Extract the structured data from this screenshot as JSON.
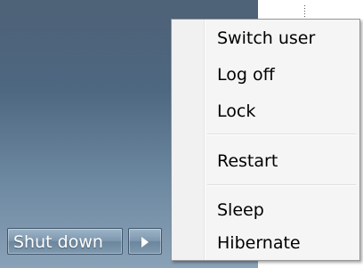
{
  "start_menu": {
    "shutdown_label": "Shut down"
  },
  "power_menu": {
    "items": [
      {
        "label": "Switch user"
      },
      {
        "label": "Log off"
      },
      {
        "label": "Lock"
      },
      {
        "label": "Restart"
      },
      {
        "label": "Sleep"
      },
      {
        "label": "Hibernate"
      }
    ]
  },
  "icons": {
    "shutdown_options": "arrow-right-icon"
  }
}
